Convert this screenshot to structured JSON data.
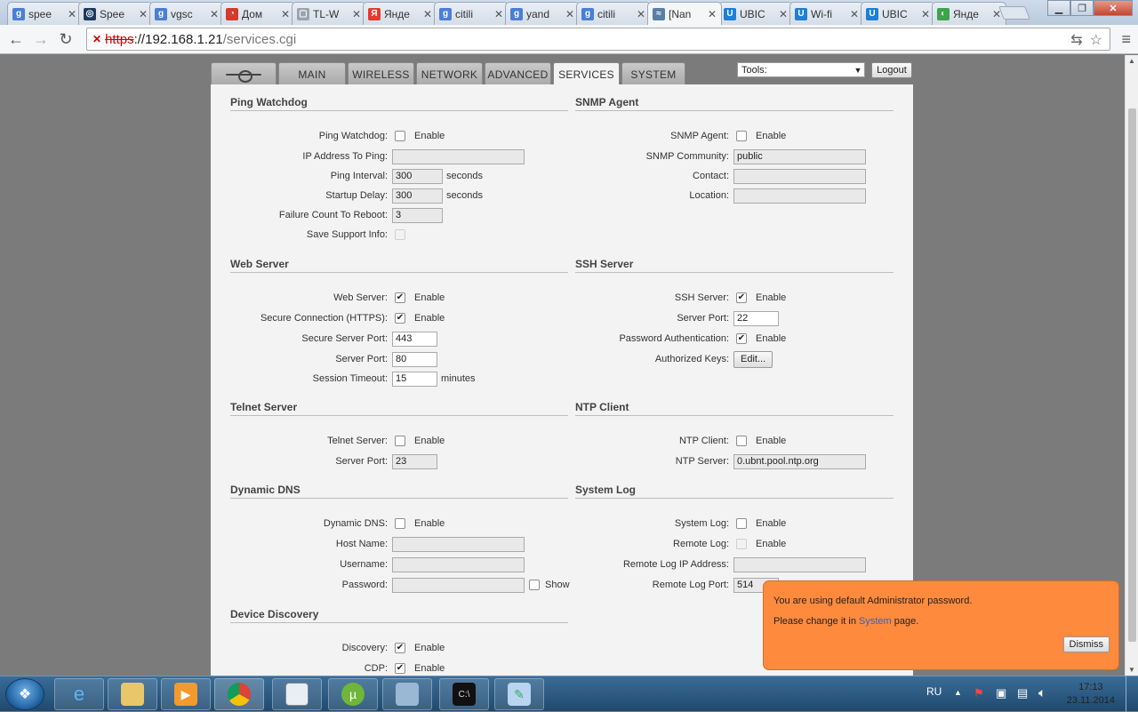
{
  "browser": {
    "tabs": [
      {
        "label": "spee",
        "icon": "google-icon",
        "color": "#4a7fd6",
        "glyph": "g"
      },
      {
        "label": "Spee",
        "icon": "speedtest-icon",
        "color": "#1b3c5f",
        "glyph": "◎"
      },
      {
        "label": "vgsc",
        "icon": "google-icon",
        "color": "#4a7fd6",
        "glyph": "g"
      },
      {
        "label": "Дом",
        "icon": "domru-icon",
        "color": "#d33b2a",
        "glyph": "◔"
      },
      {
        "label": "TL-W",
        "icon": "page-icon",
        "color": "#9aa3ad",
        "glyph": "▢"
      },
      {
        "label": "Янде",
        "icon": "yandex-icon",
        "color": "#e23b2e",
        "glyph": "Я"
      },
      {
        "label": "citili",
        "icon": "google-icon",
        "color": "#4a7fd6",
        "glyph": "g"
      },
      {
        "label": "yand",
        "icon": "google-icon",
        "color": "#4a7fd6",
        "glyph": "g"
      },
      {
        "label": "citili",
        "icon": "google-icon",
        "color": "#4a7fd6",
        "glyph": "g"
      },
      {
        "label": "[Nan",
        "icon": "rss-icon",
        "color": "#5a7fa6",
        "glyph": "≈",
        "active": true
      },
      {
        "label": "UBIC",
        "icon": "ubiquiti-icon",
        "color": "#1d7fd6",
        "glyph": "U"
      },
      {
        "label": "Wi-fi",
        "icon": "ubiquiti-icon",
        "color": "#1d7fd6",
        "glyph": "U"
      },
      {
        "label": "UBIC",
        "icon": "ubiquiti-icon",
        "color": "#1d7fd6",
        "glyph": "U"
      },
      {
        "label": "Янде",
        "icon": "yandex-market-icon",
        "color": "#3ba54a",
        "glyph": "◐"
      }
    ],
    "url": {
      "protocol": "https",
      "separator": "://",
      "host": "192.168.1.21",
      "path": "/services.cgi"
    }
  },
  "airos": {
    "nav": [
      {
        "label": "MAIN",
        "name": "nav-main"
      },
      {
        "label": "WIRELESS",
        "name": "nav-wireless"
      },
      {
        "label": "NETWORK",
        "name": "nav-network"
      },
      {
        "label": "ADVANCED",
        "name": "nav-advanced"
      },
      {
        "label": "SERVICES",
        "name": "nav-services",
        "active": true
      },
      {
        "label": "SYSTEM",
        "name": "nav-system"
      }
    ],
    "tools_label": "Tools:",
    "logout_label": "Logout"
  },
  "ping_watchdog": {
    "title": "Ping Watchdog",
    "enable_label": "Ping Watchdog:",
    "enable_text": "Enable",
    "ip_label": "IP Address To Ping:",
    "ip_value": "",
    "interval_label": "Ping Interval:",
    "interval_value": "300",
    "interval_unit": "seconds",
    "delay_label": "Startup Delay:",
    "delay_value": "300",
    "delay_unit": "seconds",
    "failure_label": "Failure Count To Reboot:",
    "failure_value": "3",
    "support_label": "Save Support Info:"
  },
  "snmp": {
    "title": "SNMP Agent",
    "enable_label": "SNMP Agent:",
    "enable_text": "Enable",
    "community_label": "SNMP Community:",
    "community_value": "public",
    "contact_label": "Contact:",
    "contact_value": "",
    "location_label": "Location:",
    "location_value": ""
  },
  "web_server": {
    "title": "Web Server",
    "enable_label": "Web Server:",
    "enable_text": "Enable",
    "https_label": "Secure Connection (HTTPS):",
    "https_text": "Enable",
    "secure_port_label": "Secure Server Port:",
    "secure_port_value": "443",
    "port_label": "Server Port:",
    "port_value": "80",
    "timeout_label": "Session Timeout:",
    "timeout_value": "15",
    "timeout_unit": "minutes"
  },
  "ssh": {
    "title": "SSH Server",
    "enable_label": "SSH Server:",
    "enable_text": "Enable",
    "port_label": "Server Port:",
    "port_value": "22",
    "pwauth_label": "Password Authentication:",
    "pwauth_text": "Enable",
    "keys_label": "Authorized Keys:",
    "keys_button": "Edit..."
  },
  "telnet": {
    "title": "Telnet Server",
    "enable_label": "Telnet Server:",
    "enable_text": "Enable",
    "port_label": "Server Port:",
    "port_value": "23"
  },
  "ntp": {
    "title": "NTP Client",
    "enable_label": "NTP Client:",
    "enable_text": "Enable",
    "server_label": "NTP Server:",
    "server_value": "0.ubnt.pool.ntp.org"
  },
  "ddns": {
    "title": "Dynamic DNS",
    "enable_label": "Dynamic DNS:",
    "enable_text": "Enable",
    "host_label": "Host Name:",
    "host_value": "",
    "user_label": "Username:",
    "user_value": "",
    "pass_label": "Password:",
    "pass_value": "",
    "show_text": "Show"
  },
  "syslog": {
    "title": "System Log",
    "enable_label": "System Log:",
    "enable_text": "Enable",
    "remote_label": "Remote Log:",
    "remote_text": "Enable",
    "ip_label": "Remote Log IP Address:",
    "ip_value": "",
    "port_label": "Remote Log Port:",
    "port_value": "514"
  },
  "discovery": {
    "title": "Device Discovery",
    "enable_label": "Discovery:",
    "enable_text": "Enable",
    "cdp_label": "CDP:",
    "cdp_text": "Enable"
  },
  "notice": {
    "line1": "You are using default Administrator password.",
    "line2_pre": "Please change it in ",
    "line2_link": "System",
    "line2_post": " page.",
    "dismiss_label": "Dismiss"
  },
  "taskbar": {
    "lang": "RU",
    "time": "17:13",
    "date": "23.11.2014"
  }
}
